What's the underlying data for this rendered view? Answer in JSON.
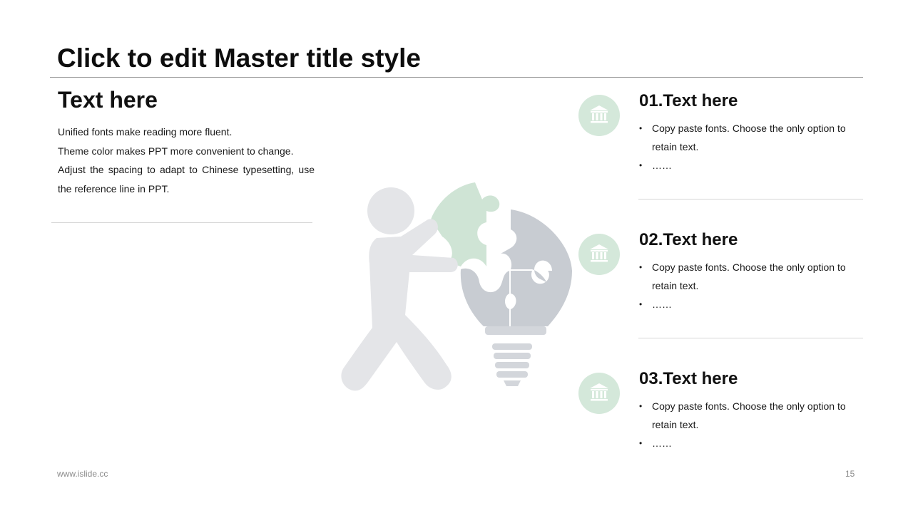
{
  "slide": {
    "title": "Click to edit Master title style",
    "left": {
      "heading": "Text here",
      "lines": [
        "Unified fonts make reading more fluent.",
        "Theme color makes PPT more convenient to change.",
        "Adjust the spacing to adapt to Chinese typesetting, use",
        "the reference line in PPT."
      ]
    },
    "items": [
      {
        "icon": "bank-icon",
        "heading": "01.Text here",
        "bullets": [
          "Copy paste fonts. Choose the only option to retain text.",
          "……"
        ]
      },
      {
        "icon": "bank-icon",
        "heading": "02.Text here",
        "bullets": [
          "Copy paste fonts. Choose the only option to retain text.",
          "……"
        ]
      },
      {
        "icon": "bank-icon",
        "heading": "03.Text here",
        "bullets": [
          "Copy paste fonts. Choose the only option to retain text.",
          "……"
        ]
      }
    ],
    "footer": {
      "website": "www.islide.cc",
      "page_number": "15"
    },
    "colors": {
      "accent_green": "#d4e8da",
      "puzzle_green": "#cfe4d5",
      "bulb_gray": "#c8ccd2",
      "figure_gray": "#e4e5e8"
    }
  }
}
